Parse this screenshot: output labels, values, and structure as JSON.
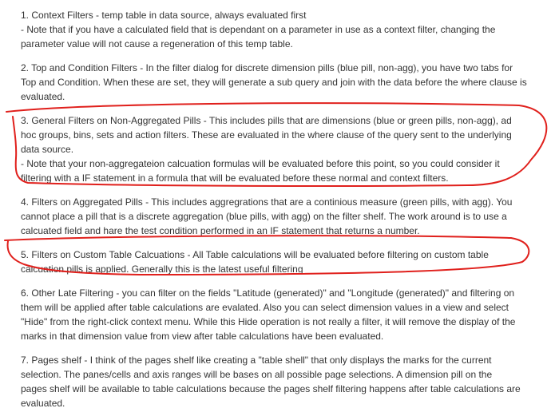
{
  "paragraphs": [
    {
      "lines": [
        "1. Context Filters - temp table in data source, always evaluated first",
        "- Note that if you have a calculated field that is dependant on a parameter in use as a context filter, changing the",
        "parameter value will not cause a regeneration of this temp table."
      ]
    },
    {
      "lines": [
        "2. Top and Condition Filters - In the filter dialog for discrete dimension pills (blue pill, non-agg), you have two tabs for",
        "Top and Condition. When these are set, they will generate a sub query and join with the data before the where clause is",
        "evaluated."
      ]
    },
    {
      "lines": [
        "3. General Filters on Non-Aggregated Pills - This includes pills that are dimensions (blue or green pills, non-agg), ad",
        "hoc groups, bins, sets and action filters. These are evaluated in the where clause of the query sent to the underlying",
        "data source.",
        "- Note that your non-aggregateion calcuation formulas will be evaluated before this point, so you could consider it",
        "filtering with a IF statement in a formula that will be evaluated before these normal and context filters."
      ]
    },
    {
      "lines": [
        "4. Filters on Aggregated Pills - This includes aggregrations that are a continious measure (green pills, with agg). You",
        "cannot place a pill that is a discrete aggregation (blue pills, with agg) on the filter shelf. The work around is to use a",
        "calcuated field and hare the test condition performed in an IF statement that returns a number."
      ]
    },
    {
      "lines": [
        "5. Filters on Custom Table Calcuations - All Table calculations will be evaluated before filtering on custom table",
        "calcuation pills is applied. Generally this is the latest useful filtering"
      ]
    },
    {
      "lines": [
        "6. Other Late Filtering - you can filter on the fields \"Latitude (generated)\" and \"Longitude (generated)\" and filtering on",
        "them will be applied after table calculations are evalated. Also you can select dimension values in a view and select",
        "\"Hide\" from the right-click context menu. While this Hide operation is not really a filter, it will remove the display of the",
        "marks in that dimension value from view after table calculations have been evaluated."
      ]
    },
    {
      "lines": [
        "7. Pages shelf - I think of the pages shelf like creating a \"table shell\" that only displays the marks for the current",
        "selection. The panes/cells and axis ranges will be bases on all possible page selections. A dimension pill on the",
        "pages shelf will be available to table calculations because the pages shelf filtering happens after table calculations are",
        "evaluated."
      ]
    }
  ],
  "annotation_color": "#e0201c"
}
